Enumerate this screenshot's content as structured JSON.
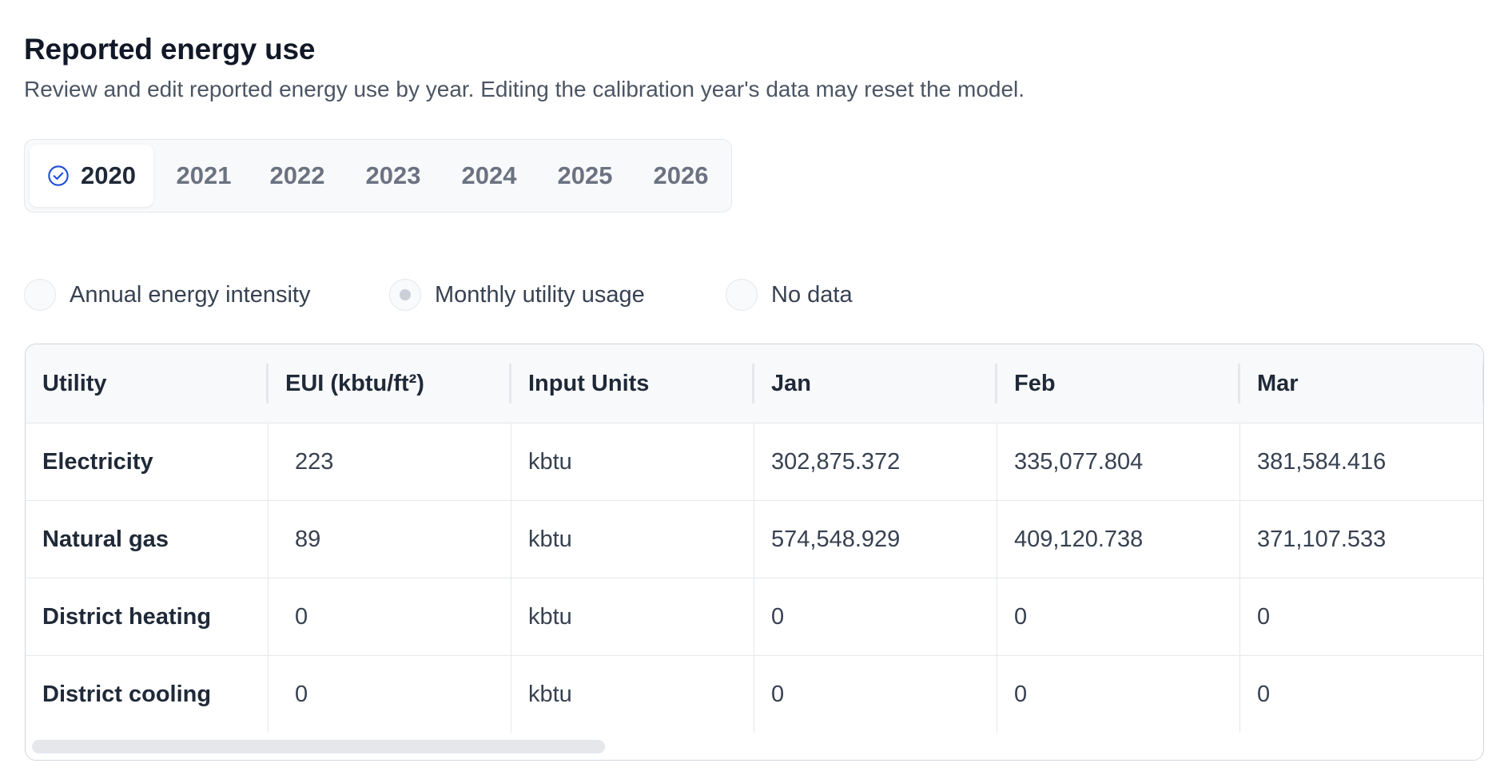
{
  "header": {
    "title": "Reported energy use",
    "subtitle": "Review and edit reported energy use by year. Editing the calibration year's data may reset the model."
  },
  "year_tabs": {
    "active": "2020",
    "active_icon": "check-circle-icon",
    "items": [
      "2020",
      "2021",
      "2022",
      "2023",
      "2024",
      "2025",
      "2026"
    ]
  },
  "data_mode": {
    "selected": "Monthly utility usage",
    "options": [
      "Annual energy intensity",
      "Monthly utility usage",
      "No data"
    ]
  },
  "table": {
    "columns": [
      "Utility",
      "EUI (kbtu/ft²)",
      "Input Units",
      "Jan",
      "Feb",
      "Mar"
    ],
    "rows": [
      [
        "Electricity",
        "223",
        "kbtu",
        "302,875.372",
        "335,077.804",
        "381,584.416"
      ],
      [
        "Natural gas",
        "89",
        "kbtu",
        "574,548.929",
        "409,120.738",
        "371,107.533"
      ],
      [
        "District heating",
        "0",
        "kbtu",
        "0",
        "0",
        "0"
      ],
      [
        "District cooling",
        "0",
        "kbtu",
        "0",
        "0",
        "0"
      ]
    ]
  },
  "colors": {
    "accent": "#1d4ed8",
    "text_primary": "#111827",
    "text_secondary": "#4b5563",
    "border": "#e5e7eb"
  }
}
